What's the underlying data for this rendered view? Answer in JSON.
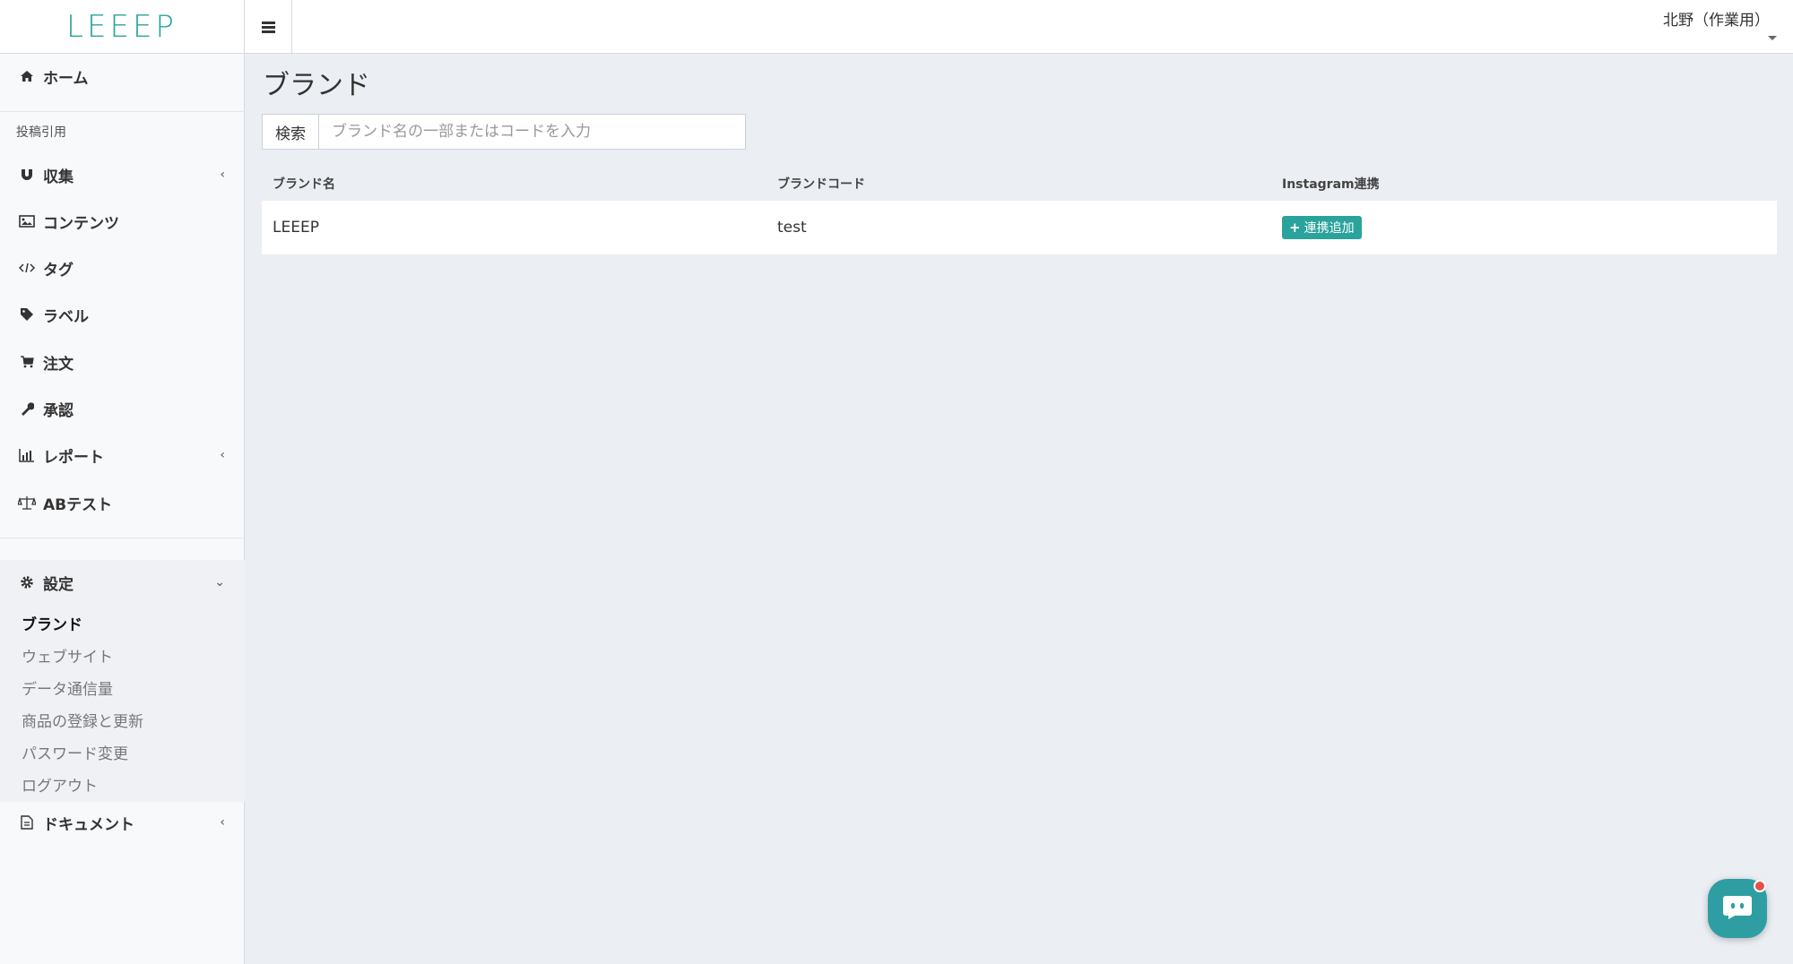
{
  "app": {
    "logo": "LEEEP"
  },
  "header": {
    "user_name": "北野（作業用）"
  },
  "sidebar": {
    "home": "ホーム",
    "section_label": "投稿引用",
    "items": [
      {
        "label": "収集",
        "icon": "magnet-icon"
      },
      {
        "label": "コンテンツ",
        "icon": "image-icon"
      },
      {
        "label": "タグ",
        "icon": "code-icon"
      },
      {
        "label": "ラベル",
        "icon": "tag-icon"
      },
      {
        "label": "注文",
        "icon": "cart-icon"
      },
      {
        "label": "承認",
        "icon": "wrench-icon"
      },
      {
        "label": "レポート",
        "icon": "bar-chart-icon"
      },
      {
        "label": "ABテスト",
        "icon": "balance-scale-icon"
      }
    ],
    "settings": {
      "label": "設定",
      "sub_items": [
        "ブランド",
        "ウェブサイト",
        "データ通信量",
        "商品の登録と更新",
        "パスワード変更",
        "ログアウト"
      ],
      "active": "ブランド"
    },
    "documents": "ドキュメント"
  },
  "main": {
    "title": "ブランド",
    "search": {
      "label": "検索",
      "placeholder": "ブランド名の一部またはコードを入力"
    },
    "table": {
      "headers": [
        "ブランド名",
        "ブランドコード",
        "Instagram連携"
      ],
      "rows": [
        {
          "name": "LEEEP",
          "code": "test",
          "action": "連携追加"
        }
      ]
    }
  },
  "colors": {
    "accent": "#2aa39c",
    "badge": "#e7504a"
  }
}
